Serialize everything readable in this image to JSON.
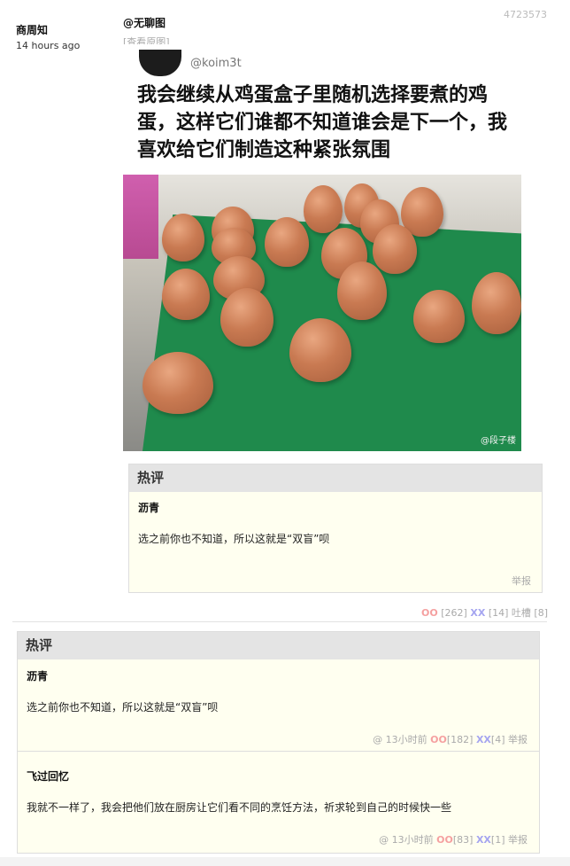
{
  "post": {
    "id": "4723573",
    "author": "商周知",
    "time": "14 hours ago",
    "op": "@无聊图",
    "view_original": "[查看原图]",
    "image": {
      "tweet_handle": "@koim3t",
      "tweet_text": "我会继续从鸡蛋盒子里随机选择要煮的鸡蛋，这样它们谁都不知道谁会是下一个，我喜欢给它们制造这种紧张氛围",
      "watermark": "@段子楼"
    },
    "stats": {
      "oo_label": "OO",
      "oo_count": "[262]",
      "xx_label": "XX",
      "xx_count": "[14]",
      "tucao_label": "吐槽",
      "tucao_count": "[8]"
    }
  },
  "inline_hot": {
    "title": "热评",
    "comment": {
      "author": "沥青",
      "text": "选之前你也不知道，所以这就是“双盲”呗",
      "report": "举报"
    }
  },
  "hot_section": {
    "title": "热评",
    "comments": [
      {
        "author": "沥青",
        "text": "选之前你也不知道，所以这就是“双盲”呗",
        "at": "@",
        "time": "13小时前",
        "oo_label": "OO",
        "oo_count": "[182]",
        "xx_label": "XX",
        "xx_count": "[4]",
        "report": "举报"
      },
      {
        "author": "飞过回忆",
        "text": "我就不一样了，我会把他们放在厨房让它们看不同的烹饪方法，祈求轮到自己的时候快一些",
        "at": "@",
        "time": "13小时前",
        "oo_label": "OO",
        "oo_count": "[83]",
        "xx_label": "XX",
        "xx_count": "[1]",
        "report": "举报"
      }
    ]
  },
  "colors": {
    "oo": "#f5a0a0",
    "xx": "#a5a5f0",
    "comment_bg": "#fffff0",
    "header_bg": "#e4e4e4"
  }
}
